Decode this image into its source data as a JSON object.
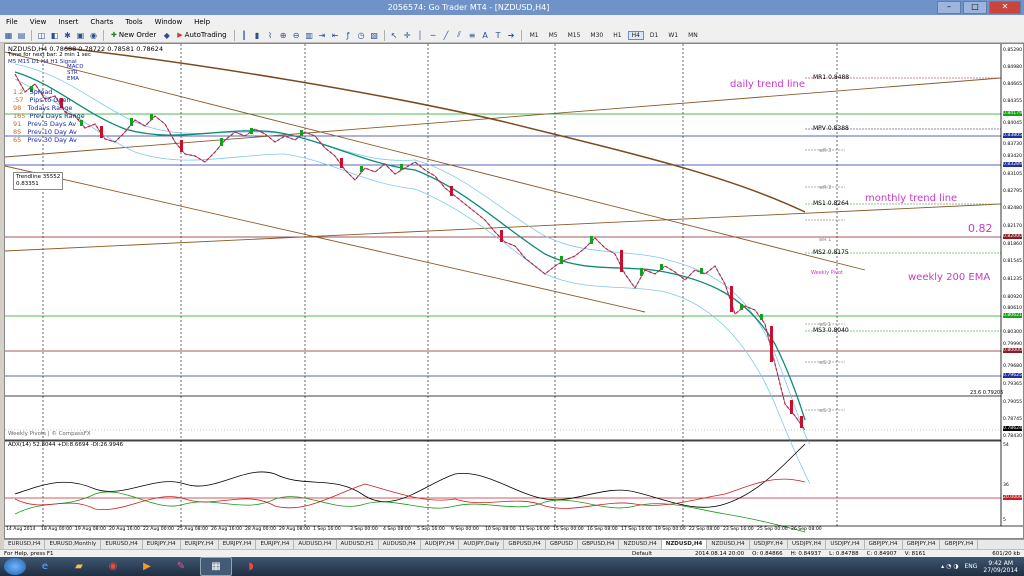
{
  "window": {
    "title": "2056574: Go Trader MT4 - [NZDUSD,H4]",
    "min": "–",
    "max": "□",
    "close": "✕"
  },
  "menu": [
    "File",
    "View",
    "Insert",
    "Charts",
    "Tools",
    "Window",
    "Help"
  ],
  "toolbar": {
    "new_order": "New Order",
    "autotrading": "AutoTrading",
    "timeframes": [
      "M1",
      "M5",
      "M15",
      "M30",
      "H1",
      "H4",
      "D1",
      "W1",
      "MN"
    ]
  },
  "chart": {
    "symbol_line": "NZDUSD,H4  0.78688 0.78722 0.78581 0.78624",
    "timer": "Time for next bar: 2 min  1 sec",
    "tf_row": "M5 M15 D1 H4 H1 Signal",
    "info_rows": [
      {
        "val": "1.2",
        "label": "Spread"
      },
      {
        "val": ".57",
        "label": "Pips to Open"
      },
      {
        "val": "98",
        "label": "Todays Range"
      },
      {
        "val": "165",
        "label": "Prev Days Range"
      },
      {
        "val": "91",
        "label": "Prev 5 Days Av"
      },
      {
        "val": "85",
        "label": "Prev 10 Day Av"
      },
      {
        "val": "65",
        "label": "Prev 30 Day Av"
      }
    ],
    "legend": [
      "MACD",
      "STR",
      "EMA"
    ],
    "trendline_box": {
      "label": "Trendline 35552",
      "value": "0.83351"
    },
    "annotations": {
      "daily": "daily trend line",
      "monthly": "monthly trend line",
      "round": "0.82",
      "ema": "weekly 200 EMA"
    },
    "pivots": {
      "mr1": "MR1",
      "mr1v": "0.8488",
      "mpv": "MPV",
      "mpvv": "0.8388",
      "ms1": "MS1",
      "ms1v": "0.8264",
      "ms2": "MS2",
      "ms2v": "0.8175",
      "ms3": "MS3",
      "ms3v": "0.8040",
      "wr3": "wR 3",
      "wr2": "wR 2",
      "wr1": "wR 1",
      "wpivot": "Weekly Pivot",
      "ws1": "wS 1",
      "ws2": "wS 2",
      "ws3": "wS 3"
    },
    "fib": "23.6  0.79205",
    "footer": "Weekly Pivots | © CompassFX",
    "adx": "ADX(14) 52.8044 +DI:8.6694 -DI:26.9946",
    "price_axis": [
      "0.85290",
      "0.84980",
      "0.84665",
      "0.84355",
      "0.84045",
      "0.83730",
      "0.83420",
      "0.83105",
      "0.82795",
      "0.82480",
      "0.82170",
      "0.81860",
      "0.81545",
      "0.81235",
      "0.80920",
      "0.80610",
      "0.80300",
      "0.79990",
      "0.79680",
      "0.79365",
      "0.79055",
      "0.78745",
      "0.78430"
    ],
    "price_tags": {
      "ema": "0.84179",
      "mpv": "0.83805",
      "r": "0.83289",
      "round": "0.82000",
      "ema200": "0.80621",
      "red": "0.80000",
      "blue": "0.79625",
      "cur": "0.78624"
    },
    "adx_axis": [
      "54",
      "36",
      "20.0000",
      "5"
    ],
    "time_axis": [
      "14 Aug 2014",
      "18 Aug 00:00",
      "19 Aug 08:00",
      "20 Aug 16:00",
      "22 Aug 00:00",
      "25 Aug 08:00",
      "26 Aug 16:00",
      "28 Aug 00:00",
      "29 Aug 08:00",
      "1 Sep 16:00",
      "3 Sep 00:00",
      "4 Sep 08:00",
      "5 Sep 16:00",
      "9 Sep 00:00",
      "10 Sep 08:00",
      "11 Sep 16:00",
      "15 Sep 00:00",
      "16 Sep 08:00",
      "17 Sep 16:00",
      "19 Sep 00:00",
      "22 Sep 08:00",
      "23 Sep 16:00",
      "25 Sep 00:00",
      "26 Sep 08:00"
    ]
  },
  "tabs": [
    "EURUSD,H4",
    "EURUSD,Monthly",
    "EURUSD,H4",
    "EURJPY,H4",
    "EURJPY,H4",
    "EURJPY,H4",
    "EURJPY,H4",
    "AUDUSD,H4",
    "AUDUSD,H1",
    "AUDUSD,H4",
    "AUDJPY,H4",
    "AUDJPY,Daily",
    "GBPUSD,H4",
    "GBPUSD",
    "GBPUSD,H4",
    "NZDUSD,H4",
    "NZDUSD,H4",
    "NZDUSD,H4",
    "USDJPY,H4",
    "USDJPY,H4",
    "USDJPY,H4",
    "GBPJPY,H4",
    "GBPJPY,H4",
    "GBPJPY,H4"
  ],
  "active_tab": 16,
  "status": {
    "help": "For Help, press F1",
    "profile": "Default",
    "time": "2014.08.14 20:00",
    "o": "O: 0.84866",
    "h": "H: 0.84937",
    "l": "L: 0.84788",
    "c": "C: 0.84907",
    "v": "V: 8161",
    "kb": "601/20 kb"
  },
  "tray": {
    "lang": "ENG",
    "time": "9:42 AM",
    "date": "27/09/2014"
  }
}
